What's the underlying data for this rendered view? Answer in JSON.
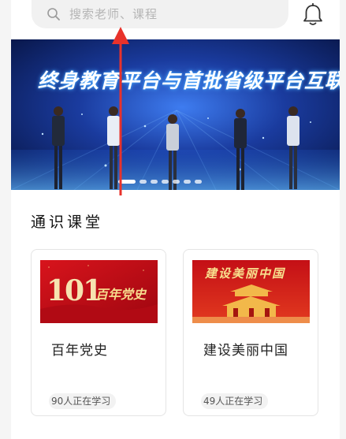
{
  "search": {
    "placeholder": "搜索老师、课程"
  },
  "header": {
    "notification_icon": "bell-icon"
  },
  "banner": {
    "headline": "终身教育平台与首批省级平台互联互通",
    "slides": 7,
    "active_slide": 1
  },
  "section": {
    "title": "通识课堂"
  },
  "courses": [
    {
      "title": "百年党史",
      "thumb_text": "百年党史",
      "thumb_number": "101",
      "learners": "90人正在学习"
    },
    {
      "title": "建设美丽中国",
      "thumb_text": "建设美丽中国",
      "learners": "49人正在学习"
    }
  ],
  "colors": {
    "accent_red": "#e8322b",
    "banner_blue": "#0a1b5e",
    "thumb_red": "#c8101a",
    "gold": "#f4c64a"
  }
}
